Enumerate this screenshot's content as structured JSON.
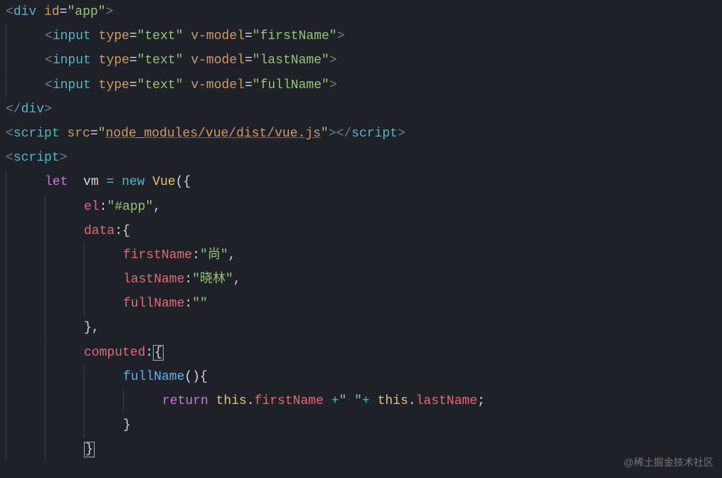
{
  "code": {
    "l1": {
      "open_bracket": "<",
      "tag": "div",
      "sp": " ",
      "attr": "id",
      "eq": "=",
      "q1": "\"",
      "val": "app",
      "q2": "\"",
      "close_bracket": ">"
    },
    "l2": {
      "open_bracket": "<",
      "tag": "input",
      "sp": " ",
      "a1": "type",
      "eq1": "=",
      "q1a": "\"",
      "v1": "text",
      "q1b": "\"",
      "a2": "v-model",
      "eq2": "=",
      "q2a": "\"",
      "v2": "firstName",
      "q2b": "\"",
      "close_bracket": ">"
    },
    "l3": {
      "open_bracket": "<",
      "tag": "input",
      "sp": " ",
      "a1": "type",
      "eq1": "=",
      "q1a": "\"",
      "v1": "text",
      "q1b": "\"",
      "a2": "v-model",
      "eq2": "=",
      "q2a": "\"",
      "v2": "lastName",
      "q2b": "\"",
      "close_bracket": ">"
    },
    "l4": {
      "open_bracket": "<",
      "tag": "input",
      "sp": " ",
      "a1": "type",
      "eq1": "=",
      "q1a": "\"",
      "v1": "text",
      "q1b": "\"",
      "a2": "v-model",
      "eq2": "=",
      "q2a": "\"",
      "v2": "fullName",
      "q2b": "\"",
      "close_bracket": ">"
    },
    "l5": {
      "open": "</",
      "tag": "div",
      "close": ">"
    },
    "l6": {
      "open": "<",
      "tag": "script",
      "sp": " ",
      "attr": "src",
      "eq": "=",
      "q1": "\"",
      "val": "node_modules/vue/dist/vue.js",
      "q2": "\"",
      "gt": ">",
      "open2": "</",
      "tag2": "script",
      "gt2": ">"
    },
    "l7": {
      "open": "<",
      "tag": "script",
      "close": ">"
    },
    "l8": {
      "kw": "let",
      "sp": "  ",
      "var": "vm",
      "sp2": " ",
      "eq": "=",
      "sp3": " ",
      "newkw": "new",
      "sp4": " ",
      "cls": "Vue",
      "paren": "(",
      "brace": "{"
    },
    "l9": {
      "prop": "el",
      "colon": ":",
      "q1": "\"",
      "val": "#app",
      "q2": "\"",
      "comma": ","
    },
    "l10": {
      "prop": "data",
      "colon": ":",
      "brace": "{"
    },
    "l11": {
      "prop": "firstName",
      "colon": ":",
      "q1": "\"",
      "val": "尚",
      "q2": "\"",
      "comma": ","
    },
    "l12": {
      "prop": "lastName",
      "colon": ":",
      "q1": "\"",
      "val": "晓林",
      "q2": "\"",
      "comma": ","
    },
    "l13": {
      "prop": "fullName",
      "colon": ":",
      "q1": "\"",
      "val": "",
      "q2": "\""
    },
    "l14": {
      "brace": "}",
      "comma": ","
    },
    "l15": {
      "prop": "computed",
      "colon": ":",
      "brace": "{"
    },
    "l16": {
      "method": "fullName",
      "paren": "()",
      "brace": "{"
    },
    "l17": {
      "ret": "return",
      "sp": " ",
      "this1": "this",
      "dot1": ".",
      "p1": "firstName",
      "sp2": " ",
      "plus1": "+",
      "q1": "\"",
      "space_lit": " ",
      "q2": "\"",
      "plus2": "+",
      "sp3": " ",
      "this2": "this",
      "dot2": ".",
      "p2": "lastName",
      "semi": ";"
    },
    "l18": {
      "brace": "}"
    },
    "l19": {
      "brace": "}"
    }
  },
  "watermark": "@稀土掘金技术社区"
}
